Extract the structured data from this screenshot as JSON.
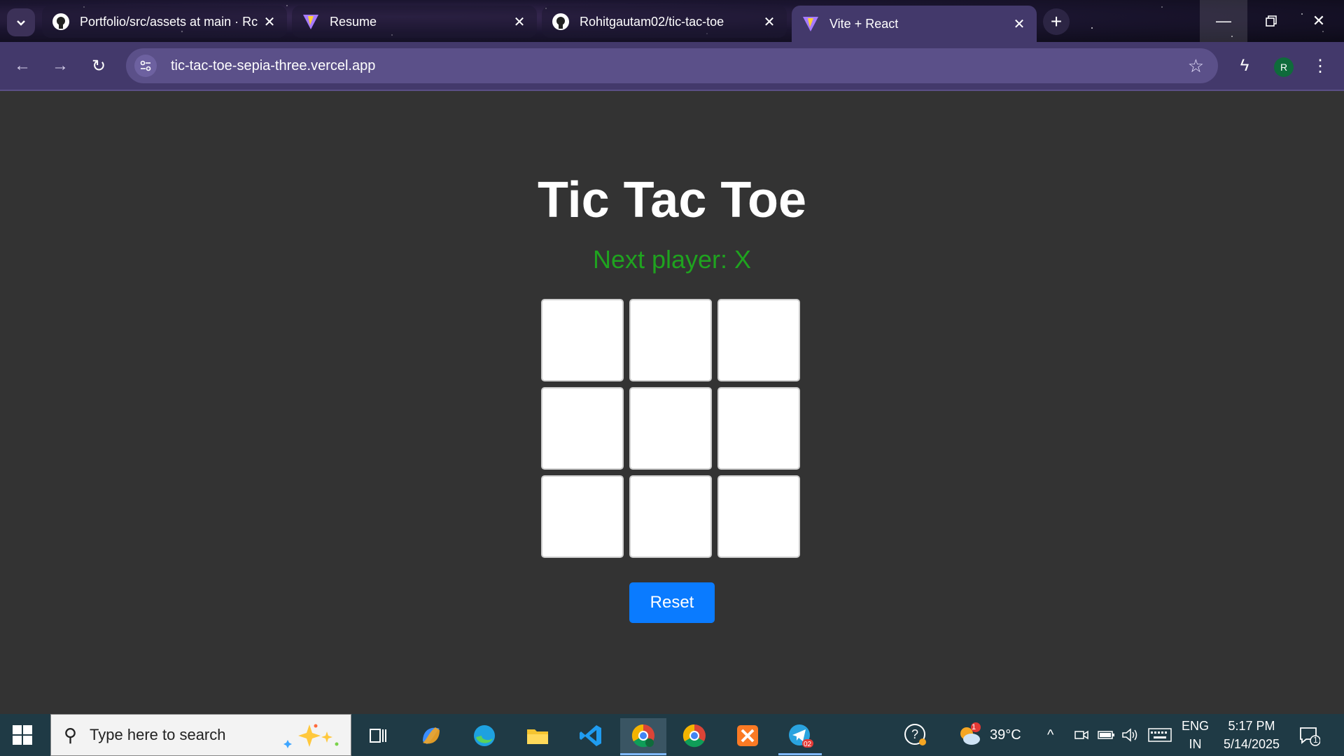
{
  "browser": {
    "tabs": [
      {
        "title": "Portfolio/src/assets at main · Rc",
        "favicon": "github-icon",
        "active": false
      },
      {
        "title": "Resume",
        "favicon": "vite-icon",
        "active": false
      },
      {
        "title": "Rohitgautam02/tic-tac-toe",
        "favicon": "github-icon",
        "active": false
      },
      {
        "title": "Vite + React",
        "favicon": "vite-icon",
        "active": true
      }
    ],
    "url": "tic-tac-toe-sepia-three.vercel.app",
    "profile_initial": "R"
  },
  "game": {
    "title": "Tic Tac Toe",
    "status": "Next player: X",
    "squares": [
      "",
      "",
      "",
      "",
      "",
      "",
      "",
      "",
      ""
    ],
    "reset_label": "Reset"
  },
  "taskbar": {
    "search_placeholder": "Type here to search",
    "weather_temp": "39°C",
    "weather_badge": "1",
    "language": "ENG",
    "region": "IN",
    "time": "5:17 PM",
    "date": "5/14/2025",
    "notification_count": "1",
    "telegram_badge": "02"
  },
  "colors": {
    "page_bg": "#333333",
    "status_green": "#1fa31f",
    "reset_blue": "#0a7bff",
    "chrome_toolbar": "#43396b"
  }
}
